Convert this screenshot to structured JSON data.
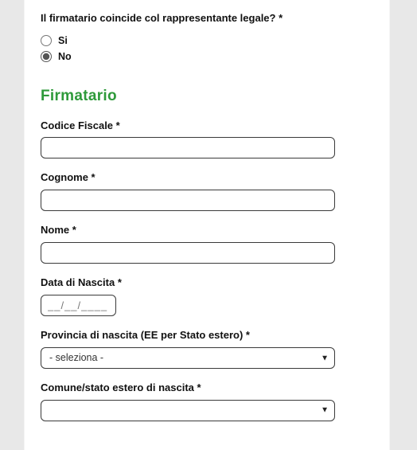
{
  "question": {
    "label": "Il firmatario coincide col rappresentante legale? *",
    "options": {
      "yes": "Si",
      "no": "No"
    }
  },
  "section": {
    "title": "Firmatario"
  },
  "fields": {
    "codice_fiscale": {
      "label": "Codice Fiscale *",
      "value": ""
    },
    "cognome": {
      "label": "Cognome *",
      "value": ""
    },
    "nome": {
      "label": "Nome *",
      "value": ""
    },
    "data_nascita": {
      "label": "Data di Nascita *",
      "placeholder": "__/__/____",
      "value": ""
    },
    "provincia": {
      "label": "Provincia di nascita (EE per Stato estero) *",
      "selected": "- seleziona -"
    },
    "comune": {
      "label": "Comune/stato estero di nascita *",
      "selected": ""
    }
  }
}
